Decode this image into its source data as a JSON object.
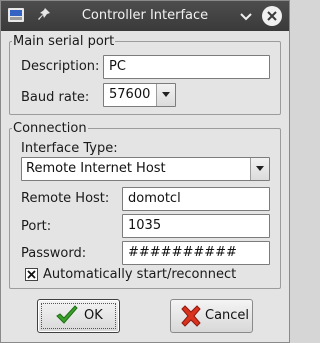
{
  "window": {
    "title": "Controller Interface",
    "icons": {
      "app": "app-logo-icon",
      "pin": "pin-icon",
      "minimize": "chevron-down-icon",
      "close": "close-icon"
    }
  },
  "main_serial_port": {
    "legend": "Main serial port",
    "description_label": "Description:",
    "description_value": "PC",
    "baud_rate_label": "Baud rate:",
    "baud_rate_value": "57600"
  },
  "connection": {
    "legend": "Connection",
    "interface_type_label": "Interface Type:",
    "interface_type_value": "Remote Internet Host",
    "remote_host_label": "Remote Host:",
    "remote_host_value": "domotcl",
    "port_label": "Port:",
    "port_value": "1035",
    "password_label": "Password:",
    "password_value": "##########",
    "auto_reconnect_label": "Automatically start/reconnect",
    "auto_reconnect_checked": true
  },
  "buttons": {
    "ok_label": "OK",
    "cancel_label": "Cancel"
  },
  "colors": {
    "ok_check": "#3aa12a",
    "cancel_x": "#d9321f",
    "titlebar": "#444444"
  }
}
